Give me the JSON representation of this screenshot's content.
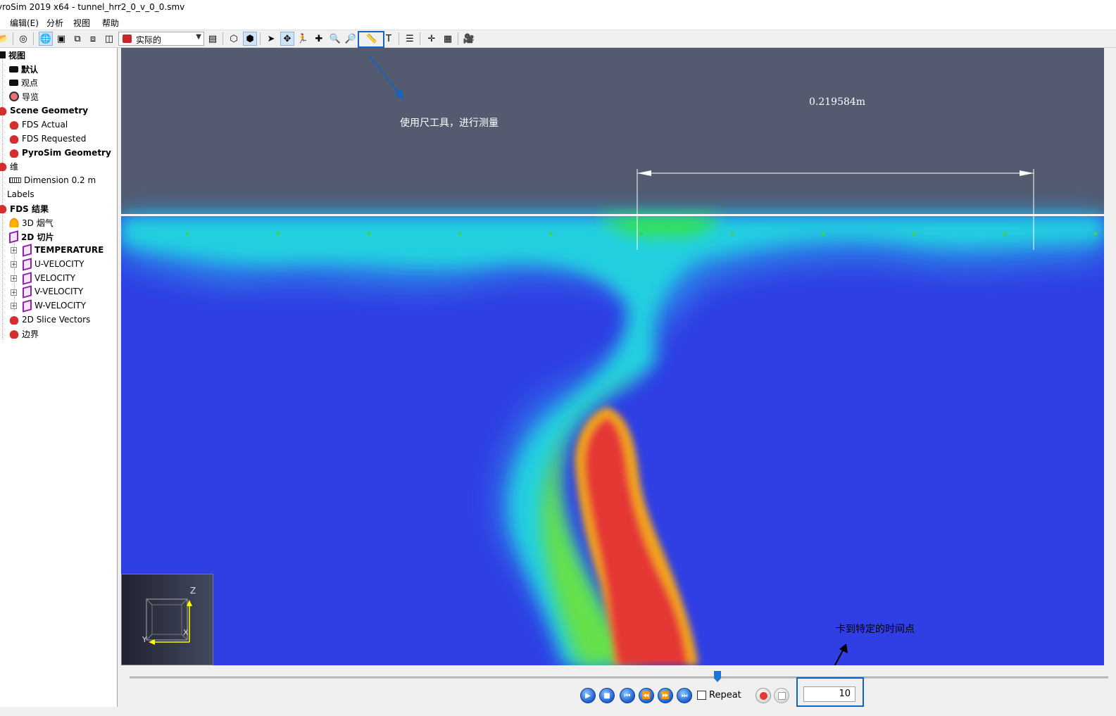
{
  "window": {
    "title": "yroSim 2019 x64 - tunnel_hrr2_0_v_0_0.smv"
  },
  "menu": {
    "items": [
      "编辑(E)",
      "分析",
      "视图",
      "帮助"
    ]
  },
  "toolbar": {
    "render_mode": "实际的",
    "icons": [
      "open-folder-icon",
      "reset-view-icon",
      "orbit-icon",
      "camera-icon",
      "view-front-icon",
      "view-side-icon",
      "view-top-icon",
      "render-mode-icon",
      "solid-view-icon",
      "wireframe-view-icon",
      "select-icon",
      "pan-icon",
      "walk-icon",
      "move-icon",
      "zoom-icon",
      "zoom-region-icon",
      "ruler-icon",
      "text-icon",
      "tree-icon",
      "axis-icon",
      "grid-icon",
      "camera-flag-icon"
    ]
  },
  "tree": {
    "items": [
      {
        "label": "视图",
        "bold": true,
        "level": 0,
        "icon": "view-icon"
      },
      {
        "label": "默认",
        "bold": true,
        "level": 1,
        "icon": "camera-icon"
      },
      {
        "label": "观点",
        "bold": false,
        "level": 1,
        "icon": "camera-icon"
      },
      {
        "label": "导览",
        "bold": false,
        "level": 1,
        "icon": "nav-icon"
      },
      {
        "label": "Scene Geometry",
        "bold": true,
        "level": 0,
        "icon": "geometry-icon"
      },
      {
        "label": "FDS Actual",
        "bold": false,
        "level": 1,
        "icon": "geometry-icon"
      },
      {
        "label": "FDS Requested",
        "bold": false,
        "level": 1,
        "icon": "geometry-icon"
      },
      {
        "label": "PyroSim Geometry",
        "bold": true,
        "level": 1,
        "icon": "geometry-icon"
      },
      {
        "label": "维",
        "bold": false,
        "level": 0,
        "icon": "geometry-icon"
      },
      {
        "label": "Dimension 0.2 m",
        "bold": false,
        "level": 1,
        "icon": "ruler-icon"
      },
      {
        "label": "Labels",
        "bold": false,
        "level": 0,
        "icon": "none"
      },
      {
        "label": "FDS 结果",
        "bold": true,
        "level": 0,
        "icon": "geometry-icon"
      },
      {
        "label": "3D 烟气",
        "bold": false,
        "level": 1,
        "icon": "smoke-icon"
      },
      {
        "label": "2D 切片",
        "bold": true,
        "level": 1,
        "icon": "slice-icon"
      },
      {
        "label": "TEMPERATURE",
        "bold": true,
        "level": 2,
        "icon": "slice-icon"
      },
      {
        "label": "U-VELOCITY",
        "bold": false,
        "level": 2,
        "icon": "slice-icon"
      },
      {
        "label": "VELOCITY",
        "bold": false,
        "level": 2,
        "icon": "slice-icon"
      },
      {
        "label": "V-VELOCITY",
        "bold": false,
        "level": 2,
        "icon": "slice-icon"
      },
      {
        "label": "W-VELOCITY",
        "bold": false,
        "level": 2,
        "icon": "slice-icon"
      },
      {
        "label": "2D Slice Vectors",
        "bold": false,
        "level": 1,
        "icon": "geometry-icon"
      },
      {
        "label": "边界",
        "bold": false,
        "level": 1,
        "icon": "geometry-icon"
      }
    ]
  },
  "viewport": {
    "dimension_label": "0.219584m",
    "axes": {
      "z": "Z",
      "x": "X",
      "y": "Y"
    },
    "colors": {
      "background_top": "#545a6f",
      "slice_low": "#2f3fe4",
      "slice_high": "#e53935"
    }
  },
  "annotations": {
    "ruler_note": "使用尺工具，进行测量",
    "time_note": "卡到特定的时间点",
    "highlight_color": "#1565c0"
  },
  "playback": {
    "repeat_label": "Repeat",
    "repeat_checked": false,
    "time_value": "10",
    "buttons": [
      "play-button",
      "stop-button",
      "skip-start-button",
      "step-back-button",
      "step-forward-button",
      "skip-end-button"
    ]
  }
}
